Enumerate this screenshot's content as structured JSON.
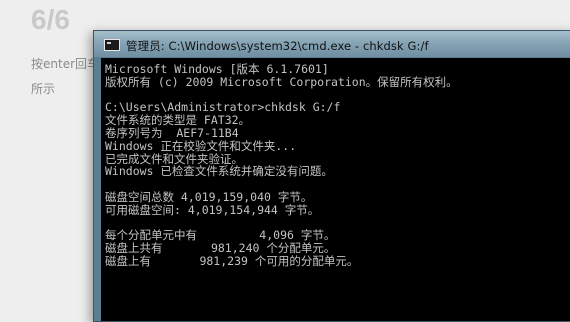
{
  "background": {
    "step": "6/6",
    "line1": "按enter回车",
    "line2": "所示"
  },
  "window": {
    "title": "管理员: C:\\Windows\\system32\\cmd.exe - chkdsk  G:/f",
    "icon": "cmd-console-icon"
  },
  "console": {
    "lines": [
      "Microsoft Windows [版本 6.1.7601]",
      "版权所有 (c) 2009 Microsoft Corporation。保留所有权利。",
      "",
      "C:\\Users\\Administrator>chkdsk G:/f",
      "文件系统的类型是 FAT32。",
      "卷序列号为  AEF7-11B4",
      "Windows 正在校验文件和文件夹...",
      "已完成文件和文件夹验证。",
      "Windows 已检查文件系统并确定没有问题。",
      "",
      "磁盘空间总数 4,019,159,040 字节。",
      "可用磁盘空间: 4,019,154,944 字节。",
      "",
      "每个分配单元中有         4,096 字节。",
      "磁盘上共有       981,240 个分配单元。",
      "磁盘上有       981,239 个可用的分配单元。"
    ]
  }
}
